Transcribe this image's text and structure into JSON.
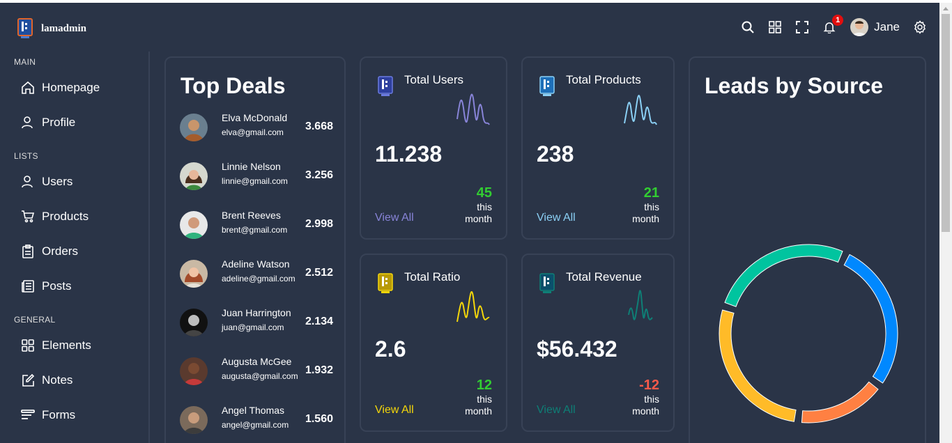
{
  "app": {
    "name": "lamadmin"
  },
  "navbar": {
    "user_name": "Jane",
    "notification_count": "1"
  },
  "sidebar": {
    "sections": [
      {
        "title": "MAIN",
        "items": [
          {
            "label": "Homepage",
            "icon": "home-icon"
          },
          {
            "label": "Profile",
            "icon": "user-icon"
          }
        ]
      },
      {
        "title": "LISTS",
        "items": [
          {
            "label": "Users",
            "icon": "user-icon"
          },
          {
            "label": "Products",
            "icon": "cart-icon"
          },
          {
            "label": "Orders",
            "icon": "clipboard-icon"
          },
          {
            "label": "Posts",
            "icon": "newspaper-icon"
          }
        ]
      },
      {
        "title": "GENERAL",
        "items": [
          {
            "label": "Elements",
            "icon": "grid-icon"
          },
          {
            "label": "Notes",
            "icon": "note-icon"
          },
          {
            "label": "Forms",
            "icon": "forms-icon"
          }
        ]
      }
    ]
  },
  "top_deals": {
    "title": "Top Deals",
    "deals": [
      {
        "name": "Elva McDonald",
        "email": "elva@gmail.com",
        "amount": "3.668"
      },
      {
        "name": "Linnie Nelson",
        "email": "linnie@gmail.com",
        "amount": "3.256"
      },
      {
        "name": "Brent Reeves",
        "email": "brent@gmail.com",
        "amount": "2.998"
      },
      {
        "name": "Adeline Watson",
        "email": "adeline@gmail.com",
        "amount": "2.512"
      },
      {
        "name": "Juan Harrington",
        "email": "juan@gmail.com",
        "amount": "2.134"
      },
      {
        "name": "Augusta McGee",
        "email": "augusta@gmail.com",
        "amount": "1.932"
      },
      {
        "name": "Angel Thomas",
        "email": "angel@gmail.com",
        "amount": "1.560"
      }
    ]
  },
  "stats": [
    {
      "title": "Total Users",
      "value": "11.238",
      "percentage": "45",
      "period": "this month",
      "link": "View All",
      "color": "#8884d8",
      "pct_color": "#32cd32"
    },
    {
      "title": "Total Products",
      "value": "238",
      "percentage": "21",
      "period": "this month",
      "link": "View All",
      "color": "#8bd0f5",
      "pct_color": "#32cd32"
    },
    {
      "title": "Total Ratio",
      "value": "2.6",
      "percentage": "12",
      "period": "this month",
      "link": "View All",
      "color": "#f5d70a",
      "pct_color": "#32cd32"
    },
    {
      "title": "Total Revenue",
      "value": "$56.432",
      "percentage": "-12",
      "period": "this month",
      "link": "View All",
      "color": "#0e7f76",
      "pct_color": "#ff5a4a"
    }
  ],
  "leads": {
    "title": "Leads by Source",
    "chart_data": {
      "type": "pie",
      "slices": [
        {
          "value": 25,
          "color": "#0088fe"
        },
        {
          "value": 15,
          "color": "#ff8042"
        },
        {
          "value": 25,
          "color": "#ffbb28"
        },
        {
          "value": 24,
          "color": "#00c49f"
        }
      ]
    }
  }
}
